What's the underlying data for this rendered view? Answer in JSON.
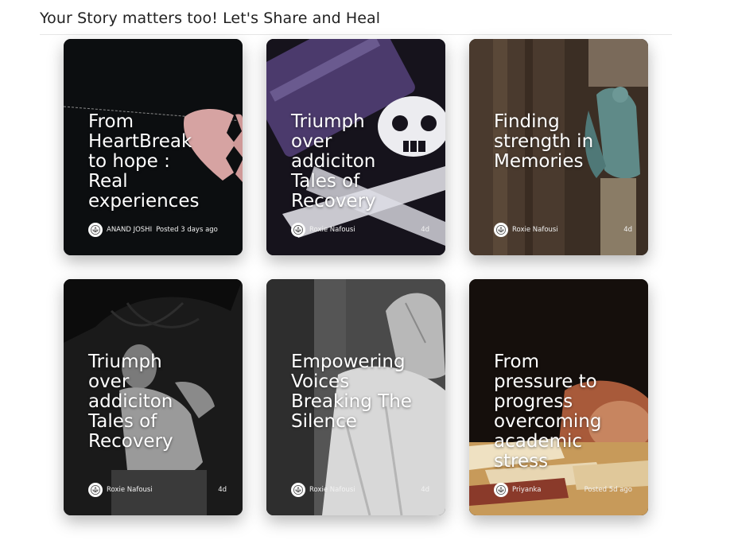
{
  "heading": "Your Story matters too! Let's Share and Heal",
  "avatar_icon": "lotus-logo-icon",
  "cards": [
    {
      "title": "From\nHeartBreak\nto hope :\nReal\nexperiences",
      "author": "ANAND JOSHI",
      "time": "Posted 3 days ago",
      "image": "broken-heart"
    },
    {
      "title": "Triumph\nover\naddiciton\nTales of\nRecovery",
      "author": "Roxie Nafousi",
      "time": "4d",
      "image": "skull-and-crossbones"
    },
    {
      "title": "Finding\nstrength in\nMemories",
      "author": "Roxie Nafousi",
      "time": "4d",
      "image": "angel-statue"
    },
    {
      "title": "Triumph\nover\naddiciton\nTales of\nRecovery",
      "author": "Roxie Nafousi",
      "time": "4d",
      "image": "woman-portrait"
    },
    {
      "title": "Empowering\nVoices\nBreaking The\nSilence",
      "author": "Roxie Nafousi",
      "time": "4d",
      "image": "hand-stop"
    },
    {
      "title": "From\npressure to\nprogress\novercoming\nacademic\nstress",
      "author": "Priyanka",
      "time": "Posted 5d ago",
      "image": "student-books"
    }
  ]
}
